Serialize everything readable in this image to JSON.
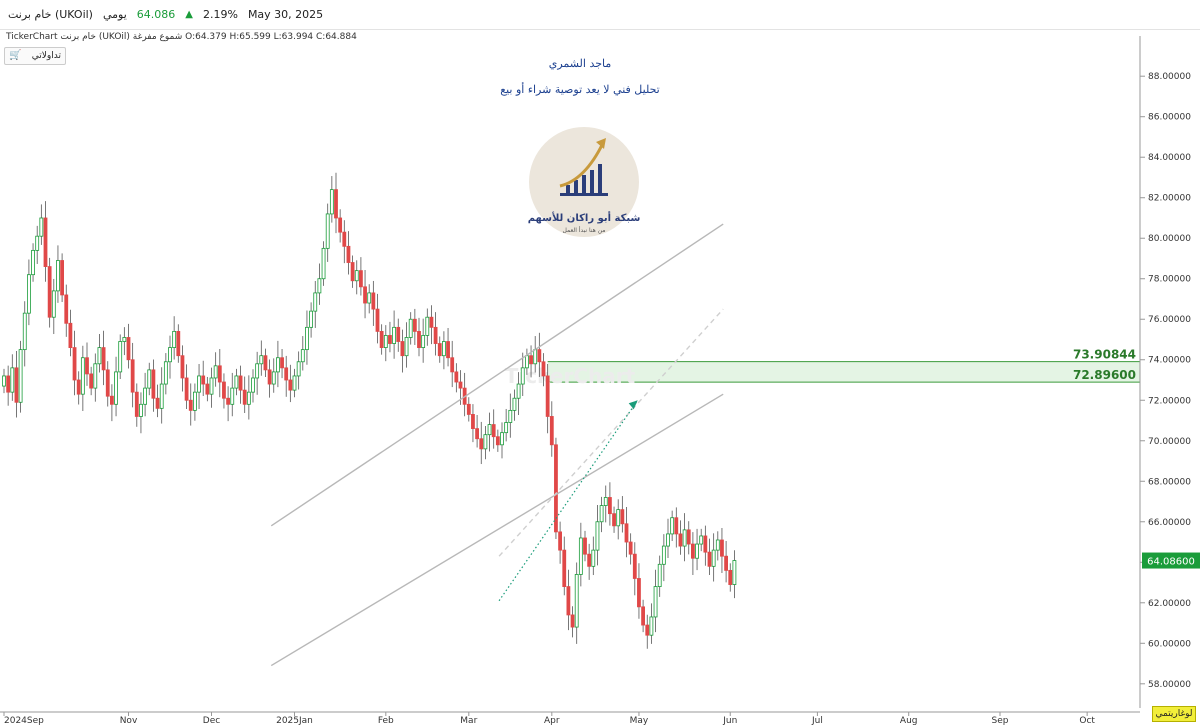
{
  "header": {
    "symbol": "خام برنت (UKOil)",
    "period": "يومي",
    "price": "64.086",
    "change_pct": "2.19%",
    "date": "May 30, 2025"
  },
  "subheader": {
    "text": "TickerChart خام برنت (UKOil) شموع مفرغة  O:64.379  H:65.599  L:63.994  C:64.884"
  },
  "trade_button": {
    "label": "تداولاتي"
  },
  "annotations": {
    "author": "ماجد الشمري",
    "note": "تحليل فني لا يعد توصية شراء أو بيع",
    "logo_name": "شبكة أبو راكان للأسهم",
    "logo_sub": "من هنا نبدأ العمل",
    "watermark": "TickerChart"
  },
  "log_button": {
    "label": "لوغاريتمي"
  },
  "colors": {
    "up": "#1a9c3a",
    "down": "#e04848",
    "zone": "#d9f0d9",
    "zone_line": "#3a9a3a"
  },
  "chart_data": {
    "type": "candlestick",
    "y_ticks": [
      "88.00000",
      "86.00000",
      "84.00000",
      "82.00000",
      "80.00000",
      "78.00000",
      "76.00000",
      "74.00000",
      "72.00000",
      "70.00000",
      "68.00000",
      "66.00000",
      "64.00000",
      "62.00000",
      "60.00000",
      "58.00000"
    ],
    "ylim": [
      57.2,
      88.8
    ],
    "x_labels": [
      "2024Sep",
      "Nov",
      "Dec",
      "2025Jan",
      "Feb",
      "Mar",
      "Apr",
      "May",
      "Jun",
      "Jul",
      "Aug",
      "Sep",
      "Oct"
    ],
    "zone": {
      "upper": 73.90844,
      "lower": 72.896,
      "upper_label": "73.90844",
      "lower_label": "72.89600"
    },
    "current_price": {
      "value": 64.086,
      "label": "64.08600"
    },
    "closes": [
      73.2,
      72.4,
      73.6,
      71.9,
      74.5,
      76.3,
      78.2,
      79.4,
      80.1,
      81.0,
      78.6,
      76.1,
      77.4,
      78.9,
      77.2,
      75.8,
      74.6,
      73.0,
      72.3,
      74.1,
      73.3,
      72.6,
      73.8,
      74.6,
      73.5,
      72.2,
      71.8,
      73.4,
      74.9,
      75.1,
      74.0,
      72.4,
      71.2,
      71.8,
      72.6,
      73.5,
      72.1,
      71.6,
      72.8,
      73.9,
      74.6,
      75.4,
      74.2,
      73.1,
      72.0,
      71.5,
      72.4,
      73.2,
      72.8,
      72.3,
      73.1,
      73.7,
      72.9,
      72.1,
      71.8,
      72.6,
      73.2,
      72.5,
      71.8,
      72.4,
      73.1,
      73.8,
      74.2,
      73.5,
      72.8,
      73.4,
      74.1,
      73.6,
      73.0,
      72.5,
      73.2,
      73.9,
      74.5,
      75.6,
      76.4,
      77.3,
      78.0,
      79.5,
      81.2,
      82.4,
      81.0,
      80.3,
      79.6,
      78.8,
      77.9,
      78.4,
      77.6,
      76.8,
      77.3,
      76.5,
      75.4,
      74.6,
      75.2,
      74.8,
      75.6,
      74.9,
      74.2,
      75.1,
      76.0,
      75.4,
      74.6,
      75.2,
      76.1,
      75.6,
      74.8,
      74.2,
      74.9,
      74.1,
      73.4,
      72.9,
      72.6,
      71.8,
      71.3,
      70.6,
      70.1,
      69.6,
      70.3,
      70.8,
      70.2,
      69.8,
      70.4,
      70.9,
      71.5,
      72.1,
      72.8,
      73.6,
      74.2,
      73.8,
      74.5,
      73.9,
      73.2,
      71.2,
      69.8,
      65.5,
      64.6,
      62.8,
      61.4,
      60.8,
      63.4,
      65.2,
      64.4,
      63.8,
      64.6,
      66.0,
      66.8,
      67.2,
      66.4,
      65.8,
      66.6,
      65.9,
      65.0,
      64.4,
      63.2,
      61.8,
      60.9,
      60.4,
      61.3,
      62.8,
      63.9,
      64.8,
      65.4,
      66.2,
      65.4,
      64.8,
      65.6,
      64.9,
      64.2,
      64.9,
      65.3,
      64.5,
      63.8,
      64.6,
      65.1,
      64.3,
      63.6,
      62.9,
      64.086
    ],
    "channel": {
      "upper": [
        [
          64.4,
          65.8
        ],
        [
          173.3,
          80.7
        ]
      ],
      "lower": [
        [
          64.4,
          58.9
        ],
        [
          173.3,
          72.3
        ]
      ],
      "mid_dashed": [
        [
          119.3,
          64.3
        ],
        [
          173.3,
          76.5
        ]
      ],
      "dotted_path": [
        [
          119.3,
          62.1
        ],
        [
          152.7,
          72.0
        ]
      ]
    }
  }
}
